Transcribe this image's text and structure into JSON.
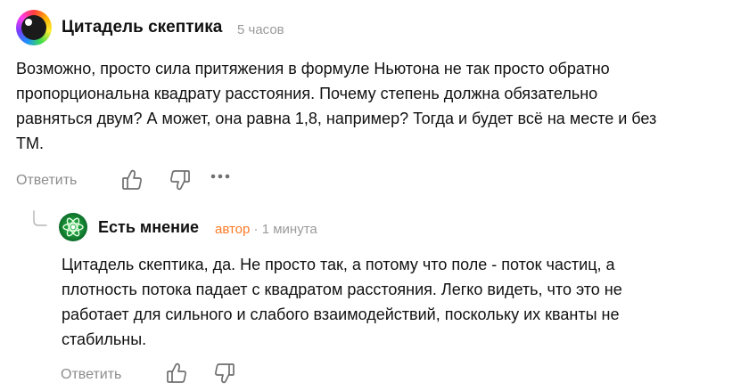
{
  "comments": [
    {
      "author": "Цитадель скептика",
      "time": "5 часов",
      "lines": [
        "Возможно, просто сила притяжения в формуле Ньютона не так просто обратно",
        "пропорциональна квадрату расстояния. Почему степень должна обязательно",
        "равняться двум? А может, она равна 1,8, например? Тогда и будет всё на месте и без",
        "ТМ."
      ],
      "reply_label": "Ответить"
    },
    {
      "author": "Есть мнение",
      "author_tag": "автор",
      "separator": " · ",
      "time": "1 минута",
      "lines": [
        "Цитадель скептика, да. Не просто так, а потому что поле - поток частиц, а",
        "плотность потока падает с квадратом расстояния. Легко видеть, что это не",
        "работает для сильного и слабого взаимодействий, поскольку их кванты не",
        "стабильны."
      ],
      "reply_label": "Ответить"
    }
  ],
  "icons": {
    "like": "thumbs-up-icon",
    "dislike": "thumbs-down-icon",
    "more": "more-dots-icon",
    "thread": "reply-thread-icon"
  },
  "colors": {
    "author_tag": "#ff7a26",
    "muted": "#9a9a9a"
  }
}
